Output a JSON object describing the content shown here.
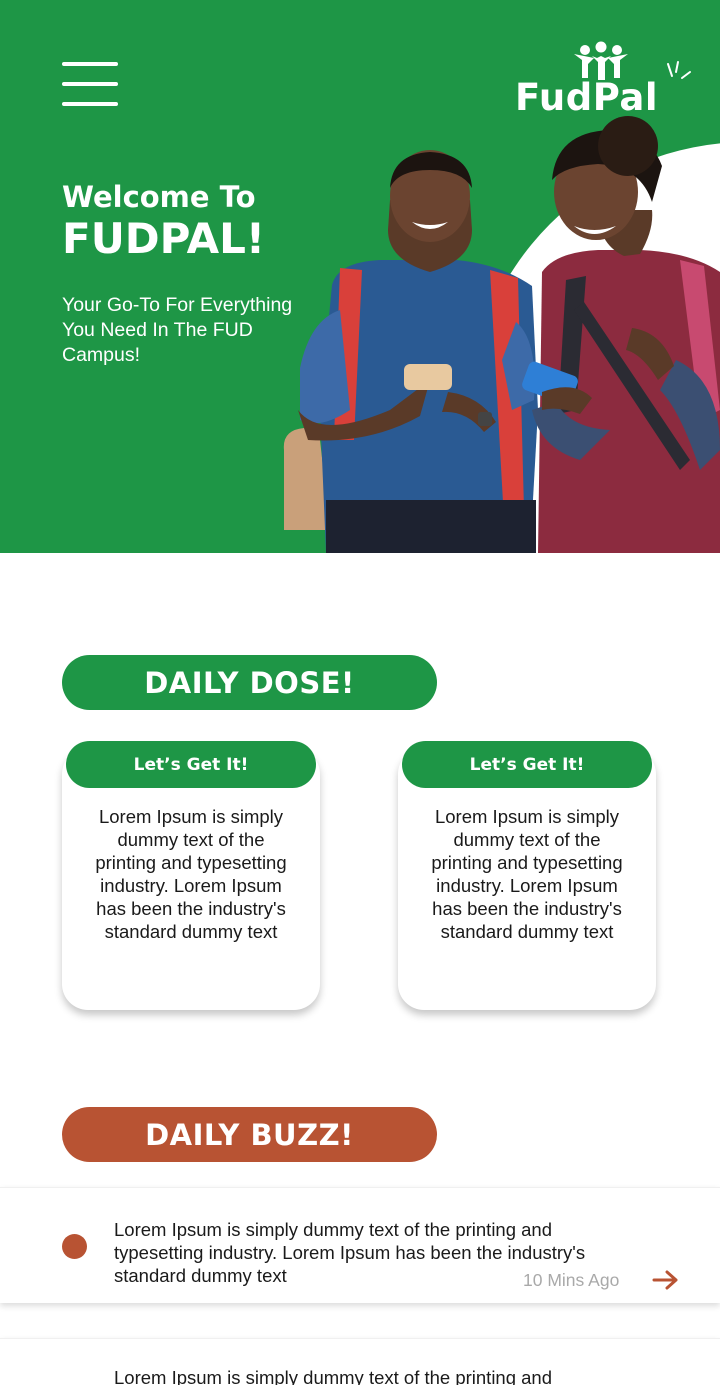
{
  "colors": {
    "brand_green": "#1e9646",
    "buzz_orange": "#b85333",
    "muted_gray": "#a9a9a9"
  },
  "header": {
    "menu_icon": "hamburger-menu-icon",
    "logo_text": "FudPal"
  },
  "hero": {
    "title_line1": "Welcome To",
    "title_line2": "FUDPAL!",
    "subtitle": "Your Go-To For Everything You Need In The FUD Campus!",
    "image": "two-students-with-phones"
  },
  "daily_dose": {
    "heading": "DAILY DOSE!",
    "cards": [
      {
        "button": "Let’s Get It!",
        "text": "Lorem Ipsum is simply dummy text of the printing and typesetting industry. Lorem Ipsum has been the industry's standard dummy text"
      },
      {
        "button": "Let’s Get It!",
        "text": "Lorem Ipsum is simply dummy text of the printing and typesetting industry. Lorem Ipsum has been the industry's standard dummy text"
      }
    ]
  },
  "daily_buzz": {
    "heading": "DAILY BUZZ!",
    "items": [
      {
        "text": "Lorem Ipsum is simply dummy text of the printing and typesetting industry. Lorem Ipsum has been the industry's standard dummy text",
        "time": "10 Mins Ago",
        "arrow_icon": "arrow-right-icon"
      },
      {
        "text": "Lorem Ipsum is simply dummy text of the printing and",
        "time": "",
        "arrow_icon": ""
      }
    ]
  }
}
